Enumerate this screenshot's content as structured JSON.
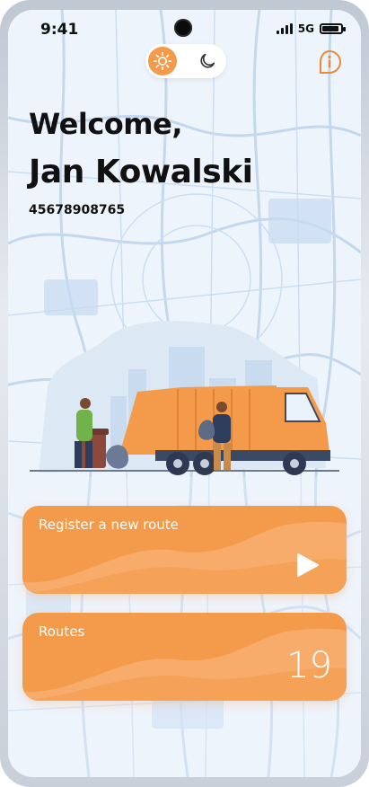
{
  "status_bar": {
    "time": "9:41",
    "network": "5G"
  },
  "theme_toggle": {
    "light": "sun-icon",
    "dark": "moon-icon"
  },
  "info": {
    "icon": "info-icon"
  },
  "greeting": {
    "welcome": "Welcome,",
    "user_name": "Jan Kowalski",
    "user_id": "45678908765"
  },
  "illustration": {
    "image": "garbage-truck-illustration"
  },
  "cards": {
    "register": {
      "label": "Register a new route",
      "icon": "play-icon"
    },
    "routes": {
      "label": "Routes",
      "count": "19"
    }
  },
  "colors": {
    "accent": "#f39a4b",
    "accent_light": "#f8b276",
    "map_background": "#eef4fb",
    "map_roads": "#a9c6e6"
  }
}
